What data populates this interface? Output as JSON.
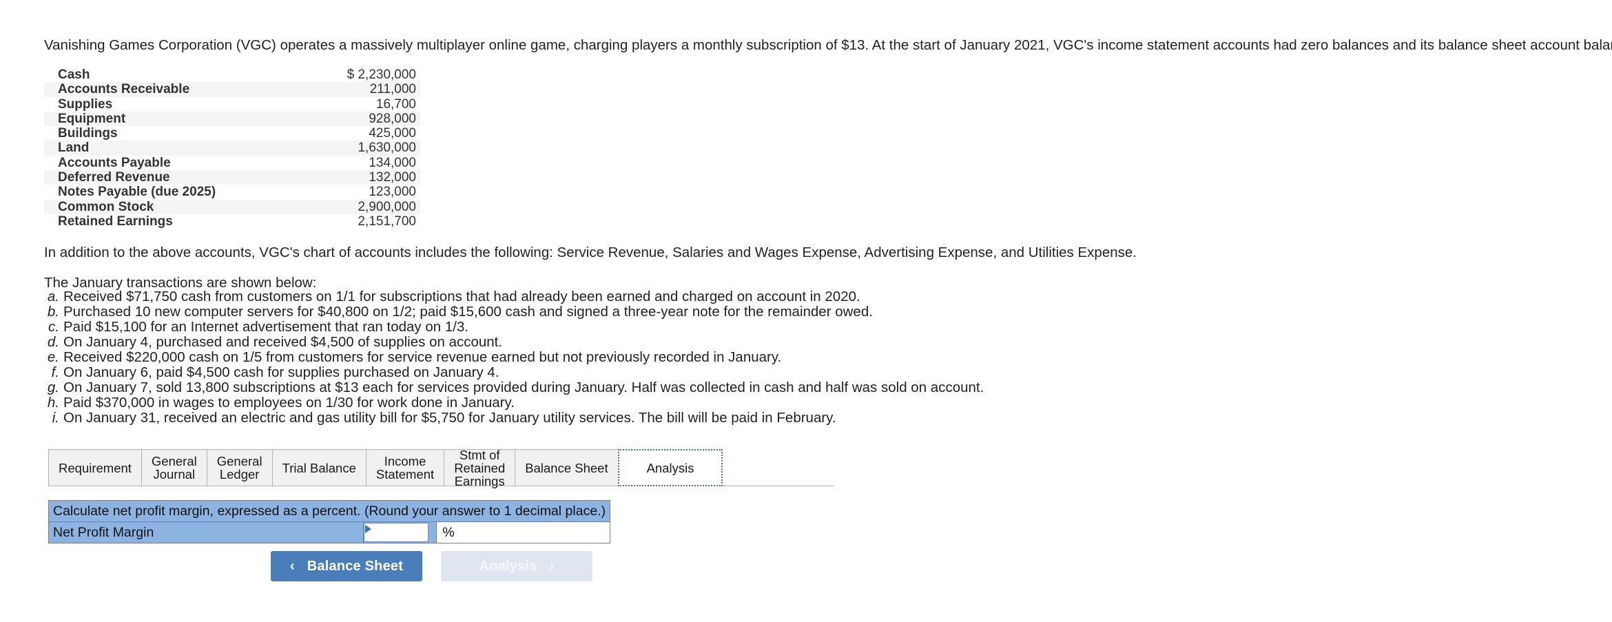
{
  "intro": {
    "text": "Vanishing Games Corporation (VGC) operates a massively multiplayer online game, charging players a monthly subscription of $13. At the start of January 2021, VGC's income statement accounts had zero balances and its balance sheet account balances were as follows:"
  },
  "balances": {
    "rows": [
      {
        "account": "Cash",
        "amount": "$ 2,230,000"
      },
      {
        "account": "Accounts Receivable",
        "amount": "211,000"
      },
      {
        "account": "Supplies",
        "amount": "16,700"
      },
      {
        "account": "Equipment",
        "amount": "928,000"
      },
      {
        "account": "Buildings",
        "amount": "425,000"
      },
      {
        "account": "Land",
        "amount": "1,630,000"
      },
      {
        "account": "Accounts Payable",
        "amount": "134,000"
      },
      {
        "account": "Deferred Revenue",
        "amount": "132,000"
      },
      {
        "account": "Notes Payable (due 2025)",
        "amount": "123,000"
      },
      {
        "account": "Common Stock",
        "amount": "2,900,000"
      },
      {
        "account": "Retained Earnings",
        "amount": "2,151,700"
      }
    ]
  },
  "chart_accounts_para": "In addition to the above accounts, VGC's chart of accounts includes the following: Service Revenue, Salaries and Wages Expense, Advertising Expense, and Utilities Expense.",
  "transactions": {
    "heading": "The January transactions are shown below:",
    "items": [
      {
        "label": "a.",
        "text": "Received $71,750 cash from customers on 1/1 for subscriptions that had already been earned and charged on account in 2020."
      },
      {
        "label": "b.",
        "text": "Purchased 10 new computer servers for $40,800 on 1/2; paid $15,600 cash and signed a three-year note for the remainder owed."
      },
      {
        "label": "c.",
        "text": "Paid $15,100 for an Internet advertisement that ran today on 1/3."
      },
      {
        "label": "d.",
        "text": "On January 4, purchased and received $4,500 of supplies on account."
      },
      {
        "label": "e.",
        "text": "Received $220,000 cash on 1/5 from customers for service revenue earned but not previously recorded in January."
      },
      {
        "label": "f.",
        "text": "On January 6, paid $4,500 cash for supplies purchased on January 4."
      },
      {
        "label": "g.",
        "text": "On January 7, sold 13,800 subscriptions at $13 each for services provided during January. Half was collected in cash and half was sold on account."
      },
      {
        "label": "h.",
        "text": "Paid $370,000 in wages to employees on 1/30 for work done in January."
      },
      {
        "label": "i.",
        "text": "On January 31, received an electric and gas utility bill for $5,750 for January utility services. The bill will be paid in February."
      }
    ]
  },
  "tabs": {
    "items": [
      {
        "label": "Requirement",
        "active": false
      },
      {
        "label": "General\nJournal",
        "active": false
      },
      {
        "label": "General\nLedger",
        "active": false
      },
      {
        "label": "Trial Balance",
        "active": false
      },
      {
        "label": "Income\nStatement",
        "active": false
      },
      {
        "label": "Stmt of\nRetained\nEarnings",
        "active": false
      },
      {
        "label": "Balance Sheet",
        "active": false
      },
      {
        "label": "Analysis",
        "active": true
      }
    ]
  },
  "answer": {
    "prompt": "Calculate net profit margin, expressed as a percent. (Round your answer to 1 decimal place.)",
    "row_label": "Net Profit Margin",
    "input_value": "",
    "input_placeholder": "",
    "unit": "%"
  },
  "nav": {
    "prev_label": "Balance Sheet",
    "prev_chevron": "‹",
    "next_label": "Analysis",
    "next_chevron": "›"
  },
  "colors": {
    "accent_blue": "#8db3e2",
    "button_blue": "#4a7ebb",
    "button_disabled": "#dfe6ef",
    "focus_border": "#3f6fb5"
  }
}
